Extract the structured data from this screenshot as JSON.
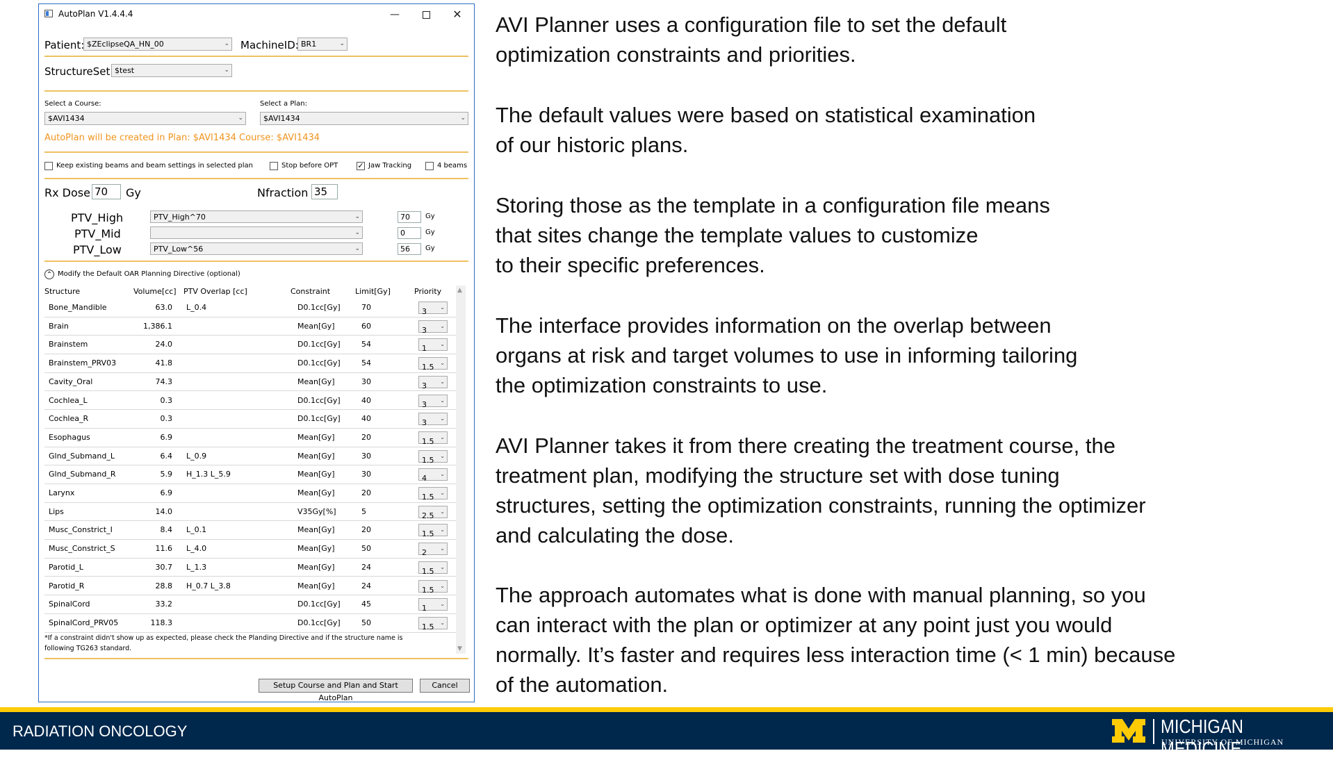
{
  "window": {
    "title": "AutoPlan V1.4.4.4",
    "minimize": "—",
    "close": "✕"
  },
  "patient": {
    "label": "Patient:",
    "value": "$ZEclipseQA_HN_00"
  },
  "machine": {
    "label": "MachineID:",
    "value": "BR1"
  },
  "structureset": {
    "label": "StructureSet:",
    "value": "$test"
  },
  "course": {
    "label": "Select a Course:",
    "value": "$AVI1434"
  },
  "plan": {
    "label": "Select a Plan:",
    "value": "$AVI1434"
  },
  "notice": "AutoPlan will be created in  Plan: $AVI1434 Course: $AVI1434",
  "options": {
    "keep_beams": {
      "label": "Keep existing beams and beam settings in selected plan",
      "checked": false
    },
    "stop_before_opt": {
      "label": "Stop before OPT",
      "checked": false
    },
    "jaw_tracking": {
      "label": "Jaw Tracking",
      "checked": true,
      "mark": "✓"
    },
    "four_beams": {
      "label": "4 beams",
      "checked": false
    }
  },
  "rx": {
    "label": "Rx Dose",
    "value": "70",
    "unit": "Gy"
  },
  "nfraction": {
    "label": "Nfraction",
    "value": "35"
  },
  "ptv": [
    {
      "label": "PTV_High",
      "structure": "PTV_High^70",
      "dose": "70",
      "unit": "Gy"
    },
    {
      "label": "PTV_Mid",
      "structure": "",
      "dose": "0",
      "unit": "Gy"
    },
    {
      "label": "PTV_Low",
      "structure": "PTV_Low^56",
      "dose": "56",
      "unit": "Gy"
    }
  ],
  "oar_section": {
    "label": "Modify the Default OAR Planning Directive (optional)",
    "toggle": "⌃"
  },
  "table_headers": {
    "structure": "Structure",
    "volume": "Volume[cc]",
    "overlap": "PTV Overlap [cc]",
    "constraint": "Constraint",
    "limit": "Limit[Gy]",
    "priority": "Priority"
  },
  "oar_rows": [
    {
      "structure": "Bone_Mandible",
      "volume": "63.0",
      "overlap": "L_0.4",
      "constraint": "D0.1cc[Gy]",
      "limit": "70",
      "priority": "3"
    },
    {
      "structure": "Brain",
      "volume": "1,386.1",
      "overlap": "",
      "constraint": "Mean[Gy]",
      "limit": "60",
      "priority": "3"
    },
    {
      "structure": "Brainstem",
      "volume": "24.0",
      "overlap": "",
      "constraint": "D0.1cc[Gy]",
      "limit": "54",
      "priority": "1"
    },
    {
      "structure": "Brainstem_PRV03",
      "volume": "41.8",
      "overlap": "",
      "constraint": "D0.1cc[Gy]",
      "limit": "54",
      "priority": "1.5"
    },
    {
      "structure": "Cavity_Oral",
      "volume": "74.3",
      "overlap": "",
      "constraint": "Mean[Gy]",
      "limit": "30",
      "priority": "3"
    },
    {
      "structure": "Cochlea_L",
      "volume": "0.3",
      "overlap": "",
      "constraint": "D0.1cc[Gy]",
      "limit": "40",
      "priority": "3"
    },
    {
      "structure": "Cochlea_R",
      "volume": "0.3",
      "overlap": "",
      "constraint": "D0.1cc[Gy]",
      "limit": "40",
      "priority": "3"
    },
    {
      "structure": "Esophagus",
      "volume": "6.9",
      "overlap": "",
      "constraint": "Mean[Gy]",
      "limit": "20",
      "priority": "1.5"
    },
    {
      "structure": "Glnd_Submand_L",
      "volume": "6.4",
      "overlap": "L_0.9",
      "constraint": "Mean[Gy]",
      "limit": "30",
      "priority": "1.5"
    },
    {
      "structure": "Glnd_Submand_R",
      "volume": "5.9",
      "overlap": "H_1.3 L_5.9",
      "constraint": "Mean[Gy]",
      "limit": "30",
      "priority": "4"
    },
    {
      "structure": "Larynx",
      "volume": "6.9",
      "overlap": "",
      "constraint": "Mean[Gy]",
      "limit": "20",
      "priority": "1.5"
    },
    {
      "structure": "Lips",
      "volume": "14.0",
      "overlap": "",
      "constraint": "V35Gy[%]",
      "limit": "5",
      "priority": "2.5"
    },
    {
      "structure": "Musc_Constrict_I",
      "volume": "8.4",
      "overlap": "L_0.1",
      "constraint": "Mean[Gy]",
      "limit": "20",
      "priority": "1.5"
    },
    {
      "structure": "Musc_Constrict_S",
      "volume": "11.6",
      "overlap": "L_4.0",
      "constraint": "Mean[Gy]",
      "limit": "50",
      "priority": "2"
    },
    {
      "structure": "Parotid_L",
      "volume": "30.7",
      "overlap": "L_1.3",
      "constraint": "Mean[Gy]",
      "limit": "24",
      "priority": "1.5"
    },
    {
      "structure": "Parotid_R",
      "volume": "28.8",
      "overlap": "H_0.7 L_3.8",
      "constraint": "Mean[Gy]",
      "limit": "24",
      "priority": "1.5"
    },
    {
      "structure": "SpinalCord",
      "volume": "33.2",
      "overlap": "",
      "constraint": "D0.1cc[Gy]",
      "limit": "45",
      "priority": "1"
    },
    {
      "structure": "SpinalCord_PRV05",
      "volume": "118.3",
      "overlap": "",
      "constraint": "D0.1cc[Gy]",
      "limit": "50",
      "priority": "1.5"
    }
  ],
  "footnote_line1": "*If a constraint didn't show up as expected, please check the Planding Directive and if the structure name is",
  "footnote_line2": "following TG263 standard.",
  "buttons": {
    "start": "Setup Course and Plan and Start AutoPlan",
    "cancel": "Cancel"
  },
  "paragraphs": [
    [
      "AVI Planner uses a configuration file to set the default",
      "optimization constraints and priorities."
    ],
    [
      "The default values were based on statistical examination",
      "of our historic plans."
    ],
    [
      "Storing those as the template in a configuration file means",
      "that sites change  the template values to customize",
      "to their specific preferences."
    ],
    [
      "The interface provides information on the overlap between",
      "organs at risk and target volumes to use in informing tailoring",
      "the optimization constraints to use."
    ],
    [
      "AVI Planner takes it from there creating the treatment course, the",
      "treatment plan, modifying the structure set with  dose tuning",
      "structures,  setting the optimization constraints, running the optimizer",
      "and calculating the dose."
    ],
    [
      "The approach automates what is done with manual planning, so you",
      "can interact with the plan or optimizer at any point just you would",
      "normally. It’s faster and requires less interaction time (< 1 min) because",
      "of the automation."
    ]
  ],
  "footer": {
    "department": "RADIATION ONCOLOGY",
    "brand": "MICHIGAN MEDICINE",
    "sub": "UNIVERSITY OF MICHIGAN",
    "maize": "#ffcb05",
    "blue": "#00274c"
  },
  "accent": "#f0941e"
}
